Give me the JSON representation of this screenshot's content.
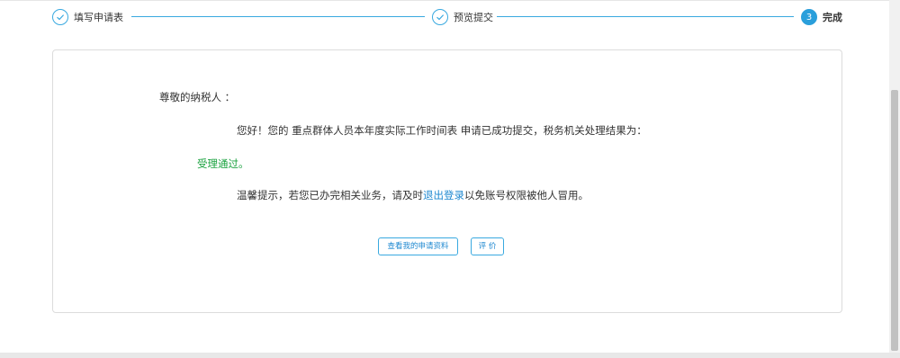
{
  "stepper": {
    "steps": [
      {
        "label": "填写申请表",
        "state": "done"
      },
      {
        "label": "预览提交",
        "state": "done"
      },
      {
        "label": "完成",
        "state": "current",
        "number": "3"
      }
    ]
  },
  "result": {
    "greeting": "尊敬的纳税人 ：",
    "message": "您好！您的 重点群体人员本年度实际工作时间表 申请已成功提交，税务机关处理结果为：",
    "status": "受理通过。",
    "tip_prefix": "温馨提示，若您已办完相关业务，请及时",
    "tip_link": "退出登录",
    "tip_suffix": "以免账号权限被他人冒用。"
  },
  "buttons": {
    "view_application": "查看我的申请资料",
    "evaluate": "评 价"
  },
  "colors": {
    "accent": "#39a9e0",
    "link": "#1e88d0",
    "success": "#1aa23f"
  }
}
